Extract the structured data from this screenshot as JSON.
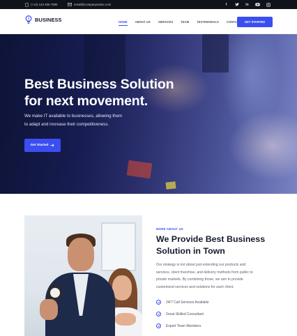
{
  "topbar": {
    "phone": "(+12) 123 456 7890",
    "email": "email@companyname.com",
    "social_icons": [
      "facebook-icon",
      "twitter-icon",
      "linkedin-icon",
      "youtube-icon",
      "instagram-icon"
    ]
  },
  "brand": {
    "name": "BUSINESS",
    "accent_color": "#3b4ef0"
  },
  "nav": {
    "items": [
      {
        "label": "HOME",
        "active": true
      },
      {
        "label": "ABOUT US",
        "active": false
      },
      {
        "label": "SERVICES",
        "active": false
      },
      {
        "label": "TEAM",
        "active": false
      },
      {
        "label": "TESTIMONIALS",
        "active": false
      },
      {
        "label": "CONTACT",
        "active": false
      }
    ],
    "cta_label": "GET STARTED"
  },
  "hero": {
    "title_line1": "Best Business Solution",
    "title_line2": "for next movement.",
    "subtitle_line1": "We make IT available to businesses, allowing them",
    "subtitle_line2": "to adapt and increase their competitiveness.",
    "button_label": "Get Started"
  },
  "about": {
    "tag": "MORE ABOUT US",
    "title_line1": "We Provide Best Business",
    "title_line2": "Solution in Town",
    "text_lines": [
      "Our strategy is not about just extending our products and",
      "services, client franchise, and delivery methods from public to",
      "private markets. By combining those, we aim to provide",
      "customized services and solutions for each client."
    ],
    "features": [
      "24/7 Call Services Available",
      "Great Skilled Consultant",
      "Expert Team Members"
    ]
  }
}
